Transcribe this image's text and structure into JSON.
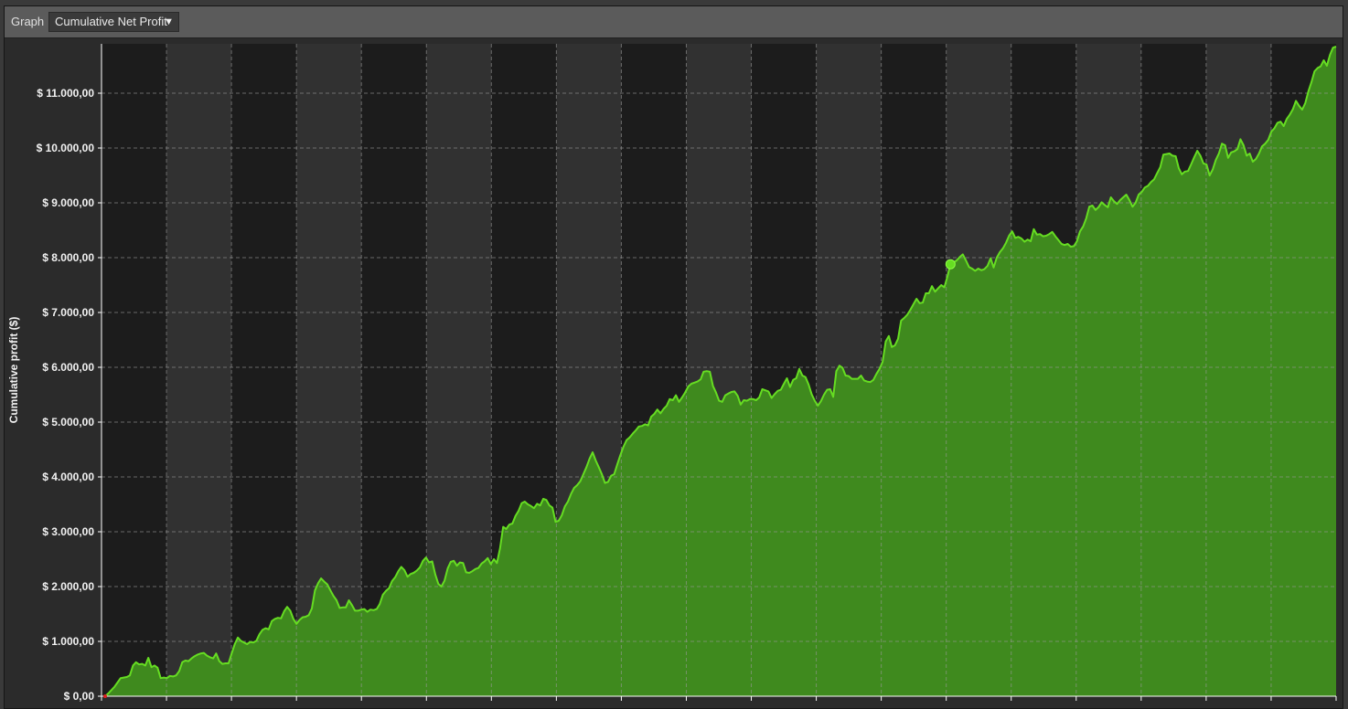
{
  "toolbar": {
    "graph_label": "Graph",
    "selected_graph": "Cumulative Net Profit",
    "dropdown_icon": "chevron-down-icon"
  },
  "colors": {
    "line": "#66dd22",
    "fill": "#3f8a1e",
    "band_dark": "#1c1c1c",
    "band_light": "#313131",
    "grid": "#9a9a9a"
  },
  "chart_data": {
    "type": "area",
    "ylabel": "Cumulative profit ($)",
    "ylim": [
      0,
      11900
    ],
    "yticks": [
      0,
      1000,
      2000,
      3000,
      4000,
      5000,
      6000,
      7000,
      8000,
      9000,
      10000,
      11000
    ],
    "ytick_labels": [
      "$ 0,00",
      "$ 1.000,00",
      "$ 2.000,00",
      "$ 3.000,00",
      "$ 4.000,00",
      "$ 5.000,00",
      "$ 6.000,00",
      "$ 7.000,00",
      "$ 8.000,00",
      "$ 9.000,00",
      "$ 10.000,00",
      "$ 11.000,00"
    ],
    "grid": true,
    "x_vgrid_count": 19,
    "x_count": 300,
    "marker_index": 274,
    "series": [
      {
        "values": [
          0,
          50,
          110,
          170,
          250,
          330,
          340,
          350,
          380,
          560,
          620,
          580,
          590,
          560,
          700,
          530,
          560,
          520,
          330,
          340,
          330,
          370,
          360,
          380,
          460,
          620,
          650,
          640,
          690,
          730,
          760,
          780,
          790,
          740,
          710,
          690,
          780,
          640,
          590,
          600,
          600,
          780,
          950,
          1070,
          1010,
          980,
          950,
          990,
          980,
          1010,
          1130,
          1210,
          1240,
          1220,
          1370,
          1410,
          1430,
          1420,
          1550,
          1630,
          1560,
          1410,
          1320,
          1390,
          1440,
          1450,
          1480,
          1600,
          1930,
          2060,
          2150,
          2090,
          2040,
          1930,
          1830,
          1750,
          1610,
          1620,
          1620,
          1750,
          1660,
          1560,
          1560,
          1580,
          1590,
          1540,
          1580,
          1570,
          1590,
          1680,
          1850,
          1920,
          1970,
          2100,
          2170,
          2280,
          2360,
          2300,
          2180,
          2230,
          2250,
          2290,
          2350,
          2470,
          2530,
          2440,
          2460,
          2220,
          2050,
          2000,
          2110,
          2330,
          2450,
          2470,
          2380,
          2440,
          2430,
          2260,
          2250,
          2280,
          2320,
          2340,
          2420,
          2460,
          2520,
          2410,
          2500,
          2430,
          2700,
          3090,
          3050,
          3130,
          3150,
          3290,
          3380,
          3520,
          3550,
          3500,
          3470,
          3430,
          3510,
          3480,
          3600,
          3580,
          3480,
          3440,
          3180,
          3200,
          3300,
          3460,
          3550,
          3690,
          3800,
          3850,
          3920,
          4050,
          4180,
          4330,
          4450,
          4300,
          4180,
          4050,
          3890,
          3910,
          4020,
          4050,
          4230,
          4400,
          4550,
          4670,
          4720,
          4790,
          4850,
          4920,
          4930,
          4960,
          4940,
          5100,
          5150,
          5230,
          5160,
          5240,
          5300,
          5420,
          5400,
          5490,
          5370,
          5450,
          5540,
          5650,
          5700,
          5720,
          5740,
          5780,
          5920,
          5930,
          5920,
          5660,
          5540,
          5390,
          5370,
          5490,
          5520,
          5550,
          5560,
          5480,
          5320,
          5400,
          5390,
          5420,
          5420,
          5400,
          5450,
          5600,
          5580,
          5560,
          5440,
          5510,
          5570,
          5590,
          5700,
          5800,
          5640,
          5770,
          5800,
          5970,
          5850,
          5820,
          5690,
          5510,
          5390,
          5300,
          5380,
          5500,
          5590,
          5600,
          5460,
          5930,
          6030,
          5990,
          5850,
          5840,
          5790,
          5790,
          5790,
          5850,
          5760,
          5740,
          5730,
          5770,
          5880,
          5970,
          6100,
          6470,
          6570,
          6370,
          6400,
          6520,
          6850,
          6900,
          6960,
          7050,
          7150,
          7250,
          7170,
          7180,
          7350,
          7350,
          7480,
          7380,
          7440,
          7500,
          7460,
          7650,
          7880,
          7910,
          7950,
          8010,
          8060,
          7950,
          7830,
          7800,
          7760,
          7800,
          7770,
          7790,
          7850,
          7990,
          7820,
          8000,
          8100,
          8170,
          8270,
          8400,
          8480,
          8360,
          8380,
          8350,
          8290,
          8330,
          8300,
          8520,
          8420,
          8430,
          8390,
          8400,
          8430,
          8470,
          8390,
          8320,
          8250,
          8230,
          8250,
          8200,
          8210,
          8300,
          8480,
          8570,
          8720,
          8930,
          8950,
          8870,
          8920,
          9010,
          8960,
          8920,
          9100,
          9030,
          8980,
          9050,
          9100,
          9150,
          9050,
          8930,
          9000,
          9150,
          9200,
          9280,
          9310,
          9380,
          9430,
          9540,
          9650,
          9880,
          9890,
          9900,
          9860,
          9850,
          9630,
          9520,
          9570,
          9580,
          9700,
          9830,
          9950,
          9860,
          9720,
          9700,
          9500,
          9610,
          9780,
          9900,
          10080,
          10050,
          9820,
          9920,
          9940,
          9980,
          10160,
          10050,
          9860,
          9900,
          9750,
          9800,
          9900,
          10030,
          10080,
          10150,
          10300,
          10360,
          10460,
          10480,
          10400,
          10530,
          10610,
          10710,
          10860,
          10770,
          10700,
          10820,
          11030,
          11200,
          11400,
          11460,
          11490,
          11600,
          11500,
          11700,
          11830,
          11850
        ]
      }
    ]
  }
}
